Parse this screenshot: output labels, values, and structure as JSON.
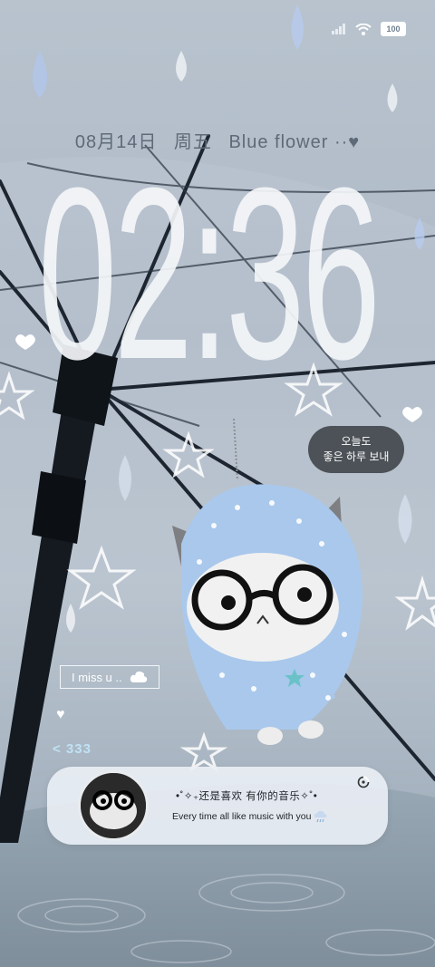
{
  "status_bar": {
    "battery": "100"
  },
  "date_line": {
    "date": "08月14日",
    "weekday": "周五",
    "title": "Blue flower ··♥"
  },
  "clock": {
    "time": "02:36"
  },
  "bubble": {
    "line1": "오늘도",
    "line2": "좋은 하루 보내"
  },
  "miss_label": {
    "text": "I miss u .. "
  },
  "short_text": "< 333",
  "music_card": {
    "song": "•˚✧₊还是喜欢 有你的音乐✧˚•",
    "lyric": "Every time all like music with you"
  },
  "colors": {
    "accent": "#bfe2f4",
    "bubble": "#4c5257"
  }
}
